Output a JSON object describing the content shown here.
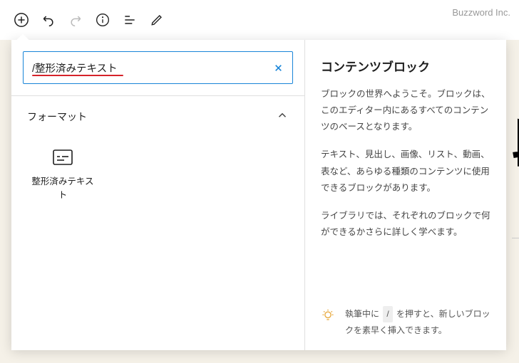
{
  "brand": "Buzzword Inc.",
  "search": {
    "value": "/整形済みテキスト"
  },
  "section": {
    "title": "フォーマット"
  },
  "blocks": [
    {
      "label": "整形済みテキスト"
    }
  ],
  "panel": {
    "title": "コンテンツブロック",
    "p1": "ブロックの世界へようこそ。ブロックは、このエディター内にあるすべてのコンテンツのベースとなります。",
    "p2": "テキスト、見出し、画像、リスト、動画、表など、あらゆる種類のコンテンツに使用できるブロックがあります。",
    "p3": "ライブラリでは、それぞれのブロックで何ができるかさらに詳しく学べます。",
    "tip_before": "執筆中に",
    "tip_key": "/",
    "tip_after": "を押すと、新しいブロックを素早く挿入できます。"
  },
  "bg_heading": "段"
}
